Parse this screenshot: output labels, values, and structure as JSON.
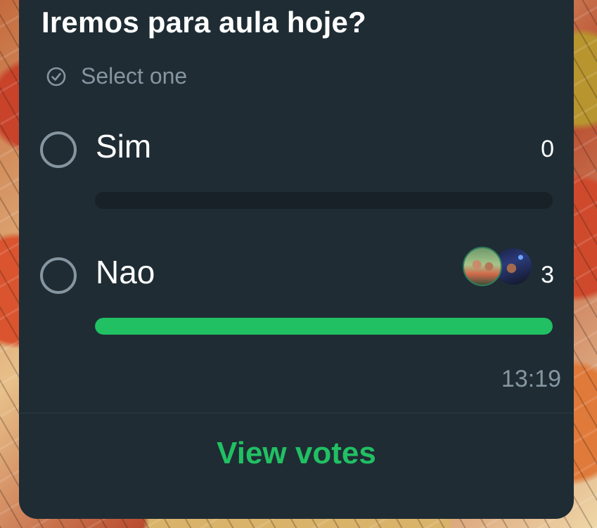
{
  "poll": {
    "question": "Iremos para aula hoje?",
    "hint": "Select one",
    "options": [
      {
        "label": "Sim",
        "votes": "0",
        "fraction": 0
      },
      {
        "label": "Nao",
        "votes": "3",
        "fraction": 1
      }
    ],
    "time": "13:19",
    "view_votes_label": "View votes"
  },
  "colors": {
    "card_bg": "#1f2c34",
    "accent_green": "#21c063",
    "secondary_text": "#8696a0",
    "bar_track": "#172127"
  }
}
